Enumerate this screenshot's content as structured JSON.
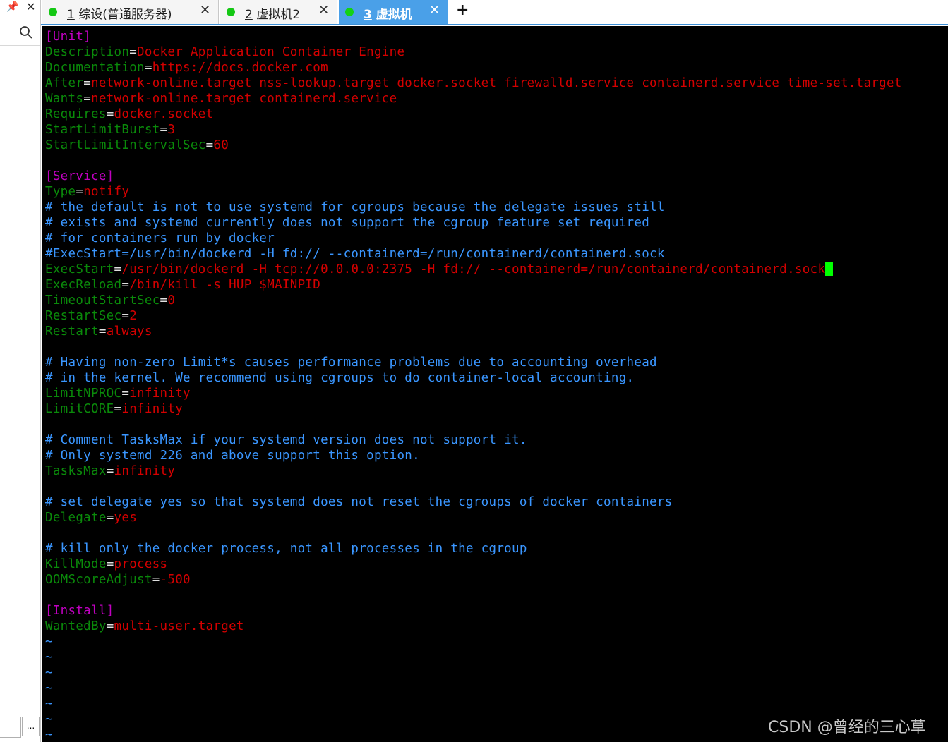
{
  "tabs": [
    {
      "number": "1",
      "title": " 综设(普通服务器)",
      "active": false
    },
    {
      "number": "2",
      "title": " 虚拟机2",
      "active": false
    },
    {
      "number": "3",
      "title": " 虚拟机",
      "active": true
    }
  ],
  "terminal": {
    "lines": [
      {
        "type": "section",
        "text": "[Unit]"
      },
      {
        "type": "kv",
        "key": "Description",
        "value": "Docker Application Container Engine"
      },
      {
        "type": "kv",
        "key": "Documentation",
        "value": "https://docs.docker.com"
      },
      {
        "type": "kv",
        "key": "After",
        "value": "network-online.target nss-lookup.target docker.socket firewalld.service containerd.service time-set.target"
      },
      {
        "type": "kv",
        "key": "Wants",
        "value": "network-online.target containerd.service"
      },
      {
        "type": "kv",
        "key": "Requires",
        "value": "docker.socket"
      },
      {
        "type": "kv",
        "key": "StartLimitBurst",
        "value": "3"
      },
      {
        "type": "kv",
        "key": "StartLimitIntervalSec",
        "value": "60"
      },
      {
        "type": "blank",
        "text": ""
      },
      {
        "type": "section",
        "text": "[Service]"
      },
      {
        "type": "kv",
        "key": "Type",
        "value": "notify"
      },
      {
        "type": "comment",
        "text": "# the default is not to use systemd for cgroups because the delegate issues still"
      },
      {
        "type": "comment",
        "text": "# exists and systemd currently does not support the cgroup feature set required"
      },
      {
        "type": "comment",
        "text": "# for containers run by docker"
      },
      {
        "type": "comment",
        "text": "#ExecStart=/usr/bin/dockerd -H fd:// --containerd=/run/containerd/containerd.sock"
      },
      {
        "type": "kv",
        "key": "ExecStart",
        "value": "/usr/bin/dockerd -H tcp://0.0.0.0:2375 -H fd:// --containerd=/run/containerd/containerd.sock"
      },
      {
        "type": "kv",
        "key": "ExecReload",
        "value": "/bin/kill -s HUP $MAINPID"
      },
      {
        "type": "kv",
        "key": "TimeoutStartSec",
        "value": "0"
      },
      {
        "type": "kv",
        "key": "RestartSec",
        "value": "2"
      },
      {
        "type": "kv",
        "key": "Restart",
        "value": "always"
      },
      {
        "type": "blank",
        "text": ""
      },
      {
        "type": "comment",
        "text": "# Having non-zero Limit*s causes performance problems due to accounting overhead"
      },
      {
        "type": "comment",
        "text": "# in the kernel. We recommend using cgroups to do container-local accounting."
      },
      {
        "type": "kv",
        "key": "LimitNPROC",
        "value": "infinity"
      },
      {
        "type": "kv",
        "key": "LimitCORE",
        "value": "infinity"
      },
      {
        "type": "blank",
        "text": ""
      },
      {
        "type": "comment",
        "text": "# Comment TasksMax if your systemd version does not support it."
      },
      {
        "type": "comment",
        "text": "# Only systemd 226 and above support this option."
      },
      {
        "type": "kv",
        "key": "TasksMax",
        "value": "infinity"
      },
      {
        "type": "blank",
        "text": ""
      },
      {
        "type": "comment",
        "text": "# set delegate yes so that systemd does not reset the cgroups of docker containers"
      },
      {
        "type": "kv",
        "key": "Delegate",
        "value": "yes"
      },
      {
        "type": "blank",
        "text": ""
      },
      {
        "type": "comment",
        "text": "# kill only the docker process, not all processes in the cgroup"
      },
      {
        "type": "kv",
        "key": "KillMode",
        "value": "process"
      },
      {
        "type": "kv",
        "key": "OOMScoreAdjust",
        "value": "-500"
      },
      {
        "type": "blank",
        "text": ""
      },
      {
        "type": "section",
        "text": "[Install]"
      },
      {
        "type": "kv",
        "key": "WantedBy",
        "value": "multi-user.target"
      },
      {
        "type": "tilde",
        "text": "~"
      },
      {
        "type": "tilde",
        "text": "~"
      },
      {
        "type": "tilde",
        "text": "~"
      },
      {
        "type": "tilde",
        "text": "~"
      },
      {
        "type": "tilde",
        "text": "~"
      },
      {
        "type": "tilde",
        "text": "~"
      },
      {
        "type": "tilde",
        "text": "~"
      }
    ]
  },
  "sidebar": {
    "more_label": "..."
  },
  "watermark": "CSDN @曾经的三心草"
}
